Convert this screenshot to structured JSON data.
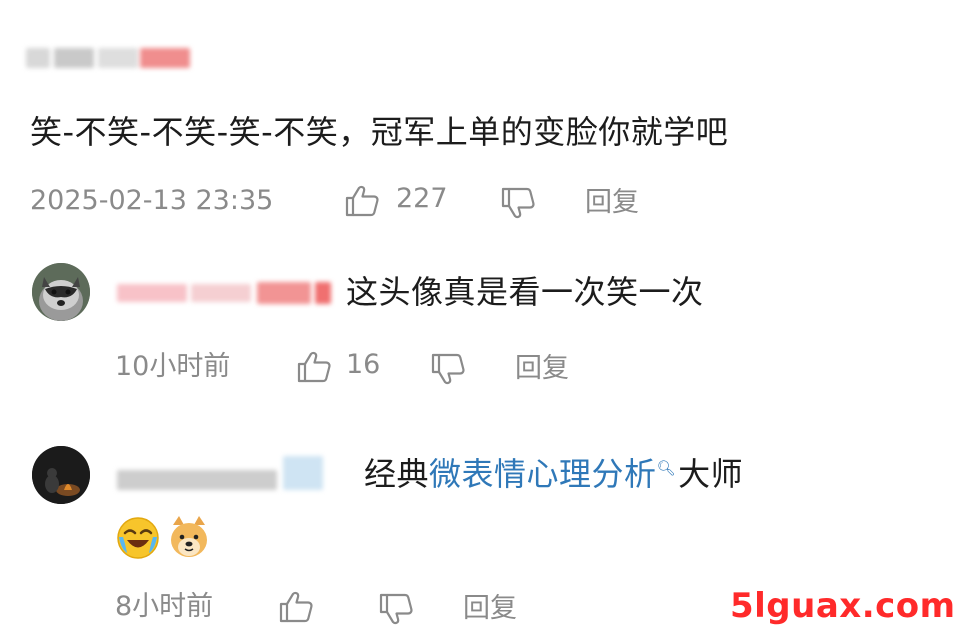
{
  "comment": {
    "text": "笑-不笑-不笑-笑-不笑，冠军上单的变脸你就学吧",
    "timestamp": "2025-02-13 23:35",
    "like_count": "227",
    "reply_label": "回复"
  },
  "replies": [
    {
      "text": "这头像真是看一次笑一次",
      "time": "10小时前",
      "like_count": "16",
      "reply_label": "回复"
    },
    {
      "text_before": "经典",
      "topic": "微表情心理分析",
      "text_after": "大师",
      "time": "8小时前",
      "reply_label": "回复"
    }
  ],
  "icons": {
    "like": "thumbs-up-icon",
    "dislike": "thumbs-down-icon",
    "topic_search": "search-icon",
    "emoji_1": "laughing-crying-emoji-icon",
    "emoji_2": "doge-emoji-icon"
  },
  "watermark": "5lguax.com",
  "colors": {
    "text": "#1c1c1c",
    "meta": "#8a8a8a",
    "topic_link": "#2f78b8",
    "watermark": "#ff2a2a"
  }
}
